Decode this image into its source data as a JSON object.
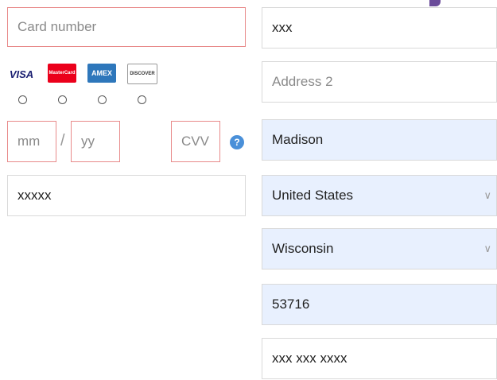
{
  "card": {
    "number_placeholder": "Card number",
    "expiry_month_placeholder": "mm",
    "expiry_separator": "/",
    "expiry_year_placeholder": "yy",
    "cvv_placeholder": "CVV",
    "help_symbol": "?",
    "zip_value": "xxxxx",
    "types": [
      {
        "label": "VISA",
        "icon": "visa-icon"
      },
      {
        "label": "MasterCard",
        "icon": "mastercard-icon"
      },
      {
        "label": "AMEX",
        "icon": "amex-icon"
      },
      {
        "label": "DISCOVER",
        "icon": "discover-icon"
      }
    ]
  },
  "address": {
    "address1_value": "xxx",
    "address2_placeholder": "Address 2",
    "city_value": "Madison",
    "country_value": "United States",
    "state_value": "Wisconsin",
    "zip_value": "53716",
    "phone_value": "xxx xxx xxxx"
  },
  "colors": {
    "invalid_border": "#e88a8a",
    "autofill_bg": "#e8f0fe",
    "help_blue": "#4a90d9"
  }
}
